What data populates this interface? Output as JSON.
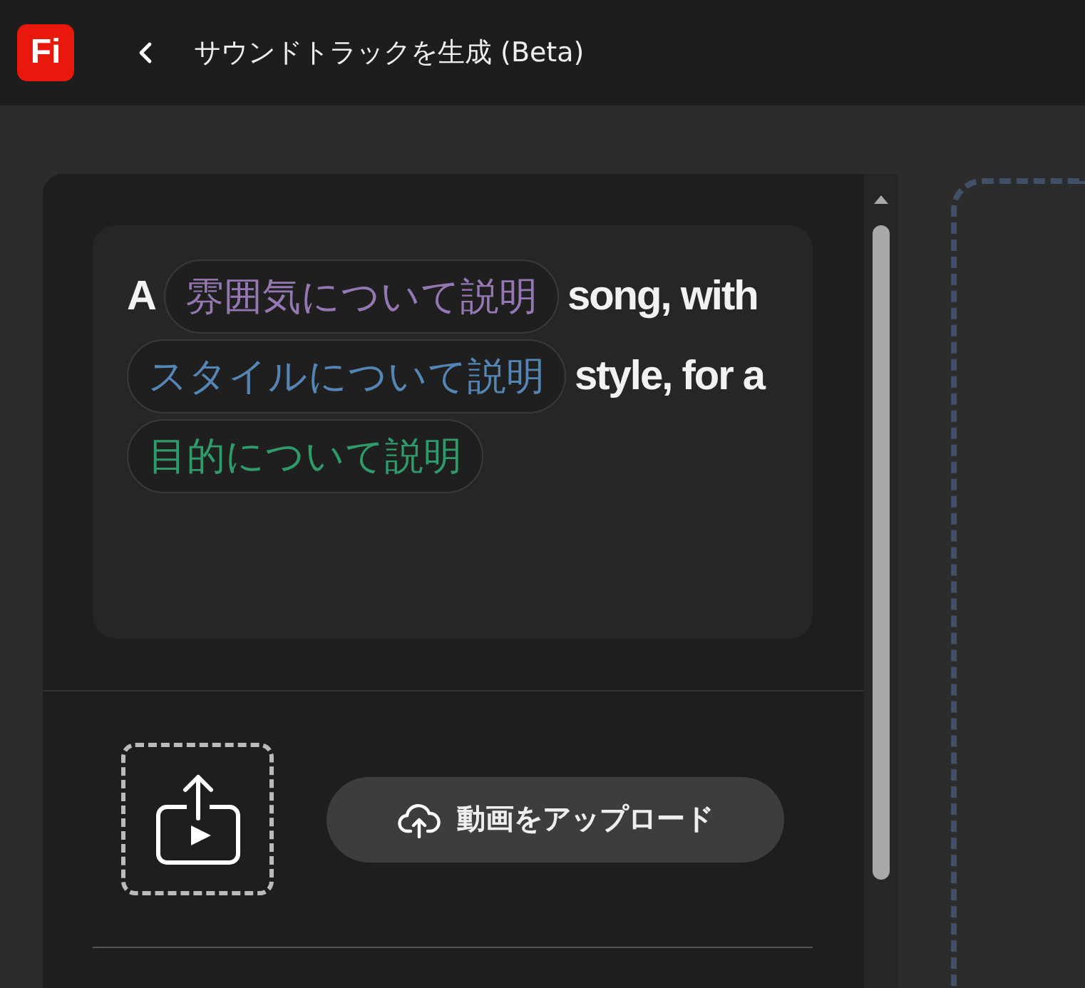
{
  "header": {
    "logo": "Fi",
    "title": "サウンドトラックを生成 (Beta)"
  },
  "prompt": {
    "parts": [
      {
        "kind": "text",
        "text": "A"
      },
      {
        "kind": "chip",
        "text": "雰囲気について説明",
        "color": "#9577b3"
      },
      {
        "kind": "text",
        "text": "song, with"
      },
      {
        "kind": "chip",
        "text": "スタイルについて説明",
        "color": "#5585b5"
      },
      {
        "kind": "text",
        "text": "style, for a"
      },
      {
        "kind": "chip",
        "text": "目的について説明",
        "color": "#2f9a6a"
      }
    ]
  },
  "upload": {
    "button": "動画をアップロード"
  }
}
